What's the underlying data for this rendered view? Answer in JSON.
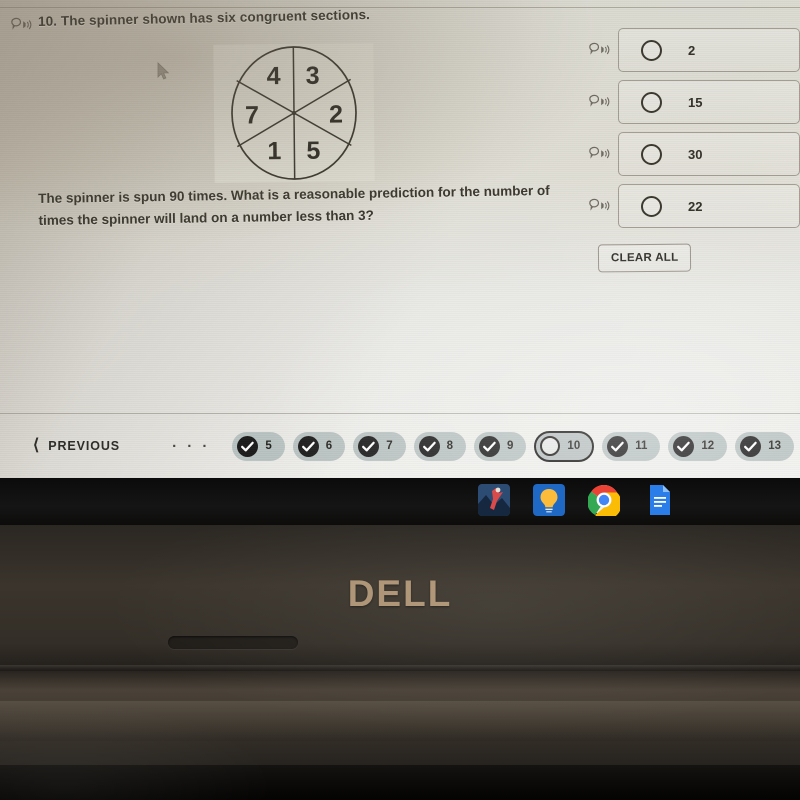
{
  "device": {
    "brand_logo": "DELL",
    "platform": "chromeos-laptop"
  },
  "question": {
    "number_label": "10.",
    "prompt_line1": "The spinner shown has six congruent sections.",
    "body": "The spinner is spun 90 times. What is a reasonable prediction for the number of times the spinner will land on a number less than 3?",
    "read_aloud_icon": "speaker-text-to-speech-icon"
  },
  "spinner": {
    "sections_count": 6,
    "labels_clockwise_from_top_right": [
      "3",
      "2",
      "5",
      "1",
      "7",
      "4"
    ],
    "labels": [
      "4",
      "3",
      "2",
      "5",
      "1",
      "7"
    ],
    "stroke_color": "#3a372f",
    "face_color": "#dedcd2"
  },
  "answers": {
    "options": [
      {
        "label": "2",
        "selected": false,
        "read_aloud_icon": "speaker-text-to-speech-icon"
      },
      {
        "label": "15",
        "selected": false,
        "read_aloud_icon": "speaker-text-to-speech-icon"
      },
      {
        "label": "30",
        "selected": false,
        "read_aloud_icon": "speaker-text-to-speech-icon"
      },
      {
        "label": "22",
        "selected": false,
        "read_aloud_icon": "speaker-text-to-speech-icon"
      }
    ],
    "clear_all_label": "CLEAR ALL"
  },
  "navigation": {
    "previous_label": "PREVIOUS",
    "previous_icon": "chevron-left-icon",
    "ellipsis": "· · ·",
    "pages": [
      {
        "number": "5",
        "state": "answered"
      },
      {
        "number": "6",
        "state": "answered"
      },
      {
        "number": "7",
        "state": "answered"
      },
      {
        "number": "8",
        "state": "answered"
      },
      {
        "number": "9",
        "state": "answered"
      },
      {
        "number": "10",
        "state": "current"
      },
      {
        "number": "11",
        "state": "answered"
      },
      {
        "number": "12",
        "state": "answered"
      },
      {
        "number": "13",
        "state": "answered"
      }
    ],
    "answered_icon": "check-circle-icon",
    "current_icon": "empty-circle-icon",
    "pill_color": "#b9c3c2",
    "check_color": "#1c1c1c"
  },
  "shelf": {
    "apps": [
      {
        "name": "photo-app-icon",
        "running": false
      },
      {
        "name": "lightbulb-app-icon",
        "running": false
      },
      {
        "name": "chrome-browser-icon",
        "running": true
      },
      {
        "name": "google-docs-icon",
        "running": false
      }
    ],
    "background": "#0f0f0f"
  },
  "colors": {
    "screen_background": "#dedcd2",
    "text": "#3b382f",
    "dell_logo": "#b59a79",
    "bezel": "#332e27"
  }
}
